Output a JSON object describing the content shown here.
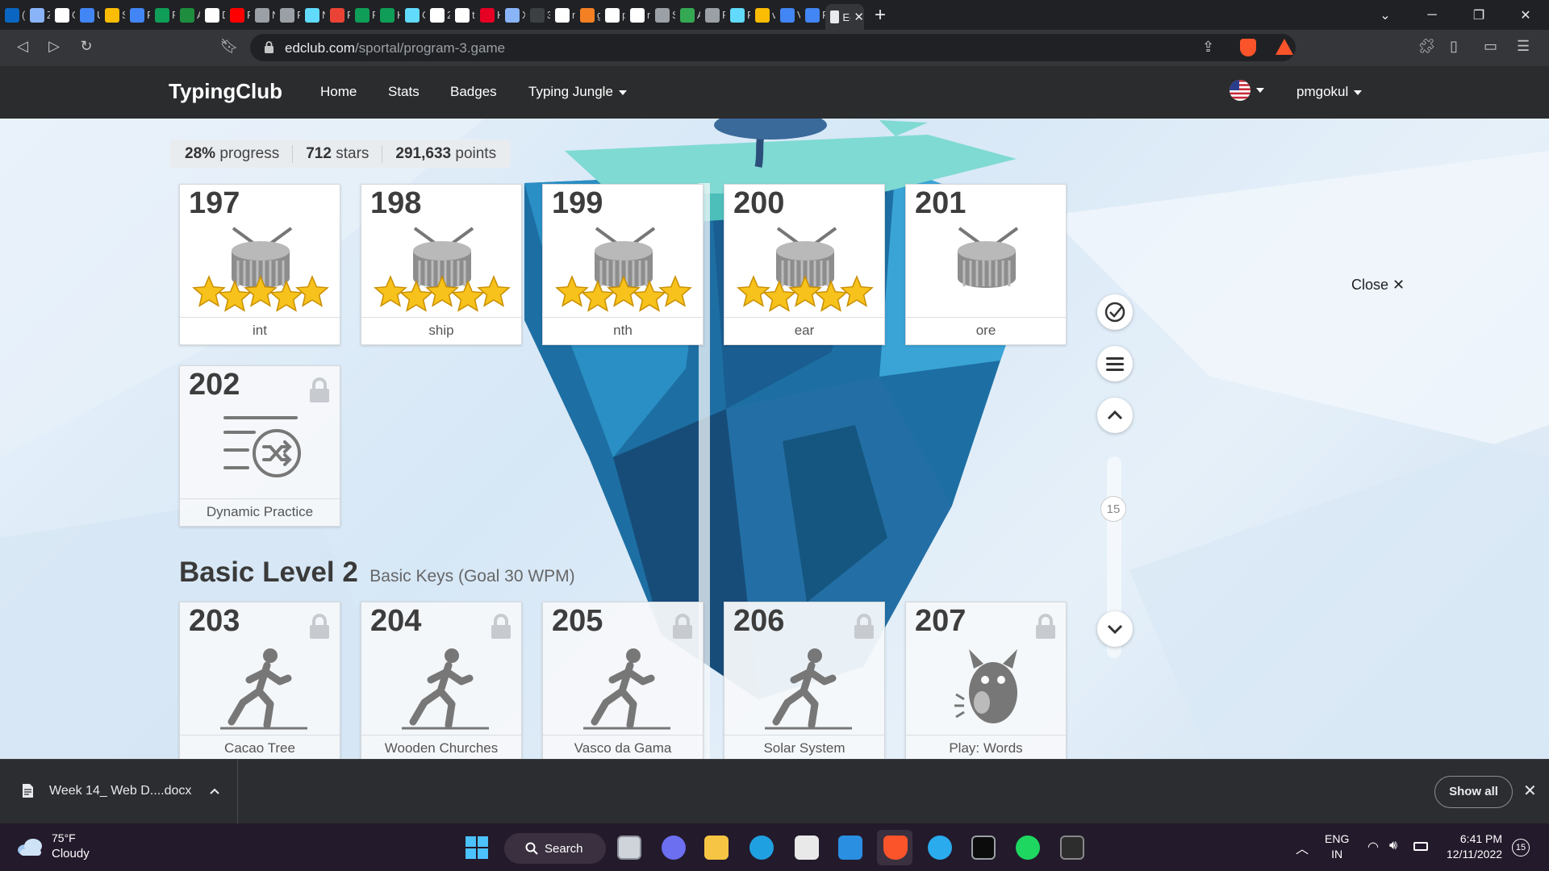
{
  "browser": {
    "tabs": [
      {
        "icon": "linkedin-icon",
        "label": "(",
        "color": "#0a66c2"
      },
      {
        "icon": "zoom-icon",
        "label": "Z",
        "color": "#8ab4f8"
      },
      {
        "icon": "google-icon",
        "label": "G",
        "color": "#ffffff"
      },
      {
        "icon": "docs-icon",
        "label": "U",
        "color": "#4285f4"
      },
      {
        "icon": "drive-icon",
        "label": "S",
        "color": "#fbbc04"
      },
      {
        "icon": "docs-icon",
        "label": "R",
        "color": "#4285f4"
      },
      {
        "icon": "w-icon",
        "label": "R",
        "color": "#0f9d58"
      },
      {
        "icon": "dp-icon",
        "label": "A",
        "color": "#1e8e3e"
      },
      {
        "icon": "medium-icon",
        "label": "D",
        "color": "#ffffff"
      },
      {
        "icon": "youtube-icon",
        "label": "R",
        "color": "#ff0000"
      },
      {
        "icon": "globe-icon",
        "label": "New",
        "color": "#9aa0a6"
      },
      {
        "icon": "globe-icon",
        "label": "R",
        "color": "#9aa0a6"
      },
      {
        "icon": "react-icon",
        "label": "N",
        "color": "#61dafb"
      },
      {
        "icon": "gmail-icon",
        "label": "R",
        "color": "#ea4335"
      },
      {
        "icon": "w-icon",
        "label": "R",
        "color": "#0f9d58"
      },
      {
        "icon": "w-icon",
        "label": "H",
        "color": "#0f9d58"
      },
      {
        "icon": "react-icon",
        "label": "C",
        "color": "#61dafb"
      },
      {
        "icon": "notion-icon",
        "label": "2",
        "color": "#ffffff"
      },
      {
        "icon": "google-icon",
        "label": "t",
        "color": "#ffffff"
      },
      {
        "icon": "pinterest-icon",
        "label": "H",
        "color": "#e60023"
      },
      {
        "icon": "flag-icon",
        "label": "X",
        "color": "#8ab4f8"
      },
      {
        "icon": "moon-icon",
        "label": "3",
        "color": "#3c4043"
      },
      {
        "icon": "github-icon",
        "label": "n",
        "color": "#ffffff"
      },
      {
        "icon": "stackoverflow-icon",
        "label": "g",
        "color": "#f48024"
      },
      {
        "icon": "github-icon",
        "label": "p",
        "color": "#ffffff"
      },
      {
        "icon": "github-icon",
        "label": "n",
        "color": "#ffffff"
      },
      {
        "icon": "globe-icon",
        "label": "S",
        "color": "#9aa0a6"
      },
      {
        "icon": "play-icon",
        "label": "A",
        "color": "#34a853"
      },
      {
        "icon": "globe-icon",
        "label": "R",
        "color": "#9aa0a6"
      },
      {
        "icon": "react-icon",
        "label": "R",
        "color": "#61dafb"
      },
      {
        "icon": "drive-icon",
        "label": "v",
        "color": "#fbbc04"
      },
      {
        "icon": "docs-icon",
        "label": "V",
        "color": "#4285f4"
      },
      {
        "icon": "docs-icon",
        "label": "R",
        "color": "#4285f4"
      }
    ],
    "active_tab": {
      "label": "Ec",
      "close": "✕"
    },
    "new_tab": "+",
    "url_domain": "edclub.com",
    "url_path": "/sportal/program-3.game"
  },
  "site": {
    "brand": "TypingClub",
    "nav": [
      "Home",
      "Stats",
      "Badges",
      "Typing Jungle"
    ],
    "user": "pmgokul"
  },
  "progress": {
    "percent": "28%",
    "percent_label": "progress",
    "stars": "712",
    "stars_label": "stars",
    "points": "291,633",
    "points_label": "points",
    "progress_fraction": 0.28
  },
  "lessons_top": [
    {
      "num": "197",
      "label": "int",
      "type": "drum",
      "stars": 5,
      "locked": false
    },
    {
      "num": "198",
      "label": "ship",
      "type": "drum",
      "stars": 5,
      "locked": false
    },
    {
      "num": "199",
      "label": "nth",
      "type": "drum",
      "stars": 5,
      "locked": false
    },
    {
      "num": "200",
      "label": "ear",
      "type": "drum",
      "stars": 5,
      "locked": false
    },
    {
      "num": "201",
      "label": "ore",
      "type": "drum",
      "stars": 0,
      "locked": false
    },
    {
      "num": "202",
      "label": "Dynamic Practice",
      "type": "shuffle",
      "stars": 0,
      "locked": true
    }
  ],
  "section": {
    "title": "Basic Level 2",
    "subtitle": "Basic Keys (Goal 30 WPM)"
  },
  "lessons_bottom": [
    {
      "num": "203",
      "label": "Cacao Tree",
      "type": "runner",
      "locked": true
    },
    {
      "num": "204",
      "label": "Wooden Churches",
      "type": "runner",
      "locked": true
    },
    {
      "num": "205",
      "label": "Vasco da Gama",
      "type": "runner",
      "locked": true
    },
    {
      "num": "206",
      "label": "Solar System",
      "type": "runner",
      "locked": true
    },
    {
      "num": "207",
      "label": "Play: Words",
      "type": "creature",
      "locked": true
    }
  ],
  "side_controls": {
    "scroll_position": "15",
    "close_label": "Close"
  },
  "download": {
    "file": "Week 14_ Web D....docx",
    "show_all": "Show all"
  },
  "taskbar": {
    "temp": "75°F",
    "condition": "Cloudy",
    "search": "Search",
    "lang_1": "ENG",
    "lang_2": "IN",
    "time": "6:41 PM",
    "date": "12/11/2022",
    "notifications": "15"
  }
}
